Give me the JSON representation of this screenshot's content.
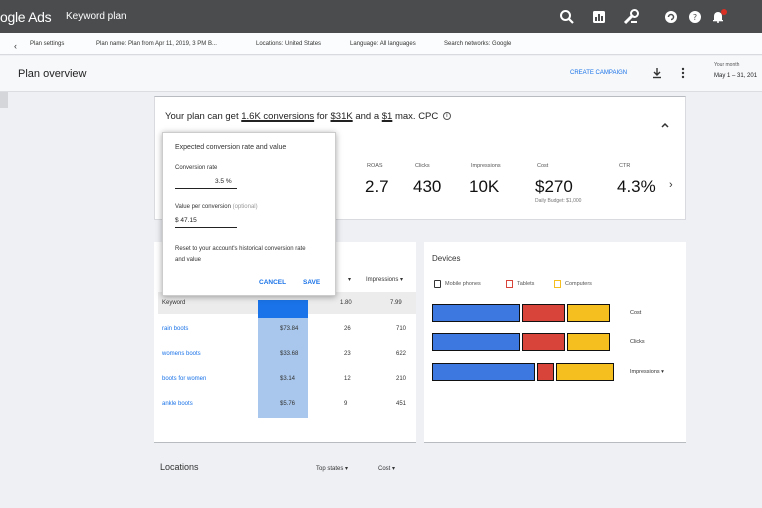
{
  "topbar": {
    "brand": "ogle Ads",
    "page_title": "Keyword plan",
    "icons": [
      "search-icon",
      "reports-icon",
      "tools-icon",
      "refresh-icon",
      "help-icon",
      "notifications-icon"
    ]
  },
  "settings": {
    "plan_settings": "Plan settings",
    "plan_name": "Plan name: Plan from Apr 11, 2019, 3 PM B...",
    "locations": "Locations: United States",
    "language": "Language: All languages",
    "network": "Search networks: Google"
  },
  "overview": {
    "title": "Plan overview",
    "create_campaign": "CREATE CAMPAIGN",
    "range_label": "Your month",
    "range_value": "May 1 – 31, 201"
  },
  "forecast": {
    "headline_pre": "Your plan can get ",
    "conversions": "1.6K conversions",
    "headline_mid1": " for ",
    "cost": "$31K",
    "headline_mid2": " and a ",
    "cpc": "$1",
    "headline_post": " max. CPC",
    "metrics": [
      {
        "label": "ROAS",
        "value": "2.7"
      },
      {
        "label": "Clicks",
        "value": "430"
      },
      {
        "label": "Impressions",
        "value": "10K"
      },
      {
        "label": "Cost",
        "value": "$270"
      },
      {
        "label": "CTR",
        "value": "4.3%"
      }
    ],
    "budget_note": "Daily Budget: $1,000"
  },
  "popup": {
    "title": "Expected conversion rate and value",
    "rate_label": "Conversion rate",
    "rate_value": "3.5 %",
    "value_label": "Value per conversion",
    "value_optional": "(optional)",
    "value_value": "$ 47.15",
    "reset_text": "Reset to your account's historical conversion rate and value",
    "cancel": "CANCEL",
    "save": "SAVE"
  },
  "table": {
    "selector1": "▾",
    "selector2": "Impressions",
    "header": [
      "Keyword",
      "",
      "1.80",
      "7.99"
    ],
    "rows": [
      {
        "keyword": "rain boots",
        "cost": "$73.84",
        "clicks": "26",
        "impr": "710"
      },
      {
        "keyword": "womens boots",
        "cost": "$33.68",
        "clicks": "23",
        "impr": "622"
      },
      {
        "keyword": "boots for women",
        "cost": "$3.14",
        "clicks": "12",
        "impr": "210"
      },
      {
        "keyword": "ankle boots",
        "cost": "$5.76",
        "clicks": "9",
        "impr": "451"
      }
    ]
  },
  "devices": {
    "title": "Devices",
    "legend": [
      "Mobile phones",
      "Tablets",
      "Computers"
    ],
    "colors": {
      "mobile": "#3c78e0",
      "tablet": "#d9443a",
      "computer": "#f4bf1f"
    },
    "bars": [
      {
        "label": "Cost",
        "shares": [
          0.47,
          0.23,
          0.23
        ]
      },
      {
        "label": "Clicks",
        "shares": [
          0.47,
          0.23,
          0.23
        ]
      },
      {
        "label": "Impressions",
        "shares": [
          0.55,
          0.09,
          0.31
        ]
      }
    ]
  },
  "locations": {
    "title": "Locations",
    "selector1": "Top states",
    "selector2": "Cost"
  }
}
